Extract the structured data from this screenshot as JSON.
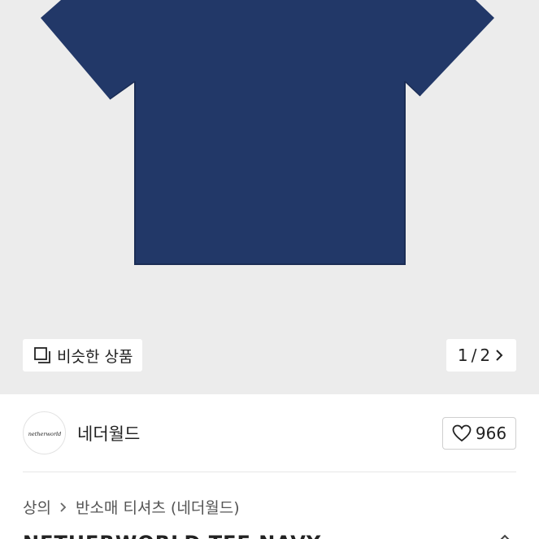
{
  "gallery": {
    "similar_label": "비슷한 상품",
    "page_current": "1",
    "page_total": "2",
    "page_sep": "/",
    "shirt_color": "#223868"
  },
  "seller": {
    "name": "네더월드",
    "logo_text": "netherworld",
    "like_count": "966"
  },
  "breadcrumb": {
    "items": [
      "상의",
      "반소매 티셔츠 (네더월드)"
    ]
  },
  "product": {
    "title_partial": "NETHERWORLD TEE NAVY"
  }
}
